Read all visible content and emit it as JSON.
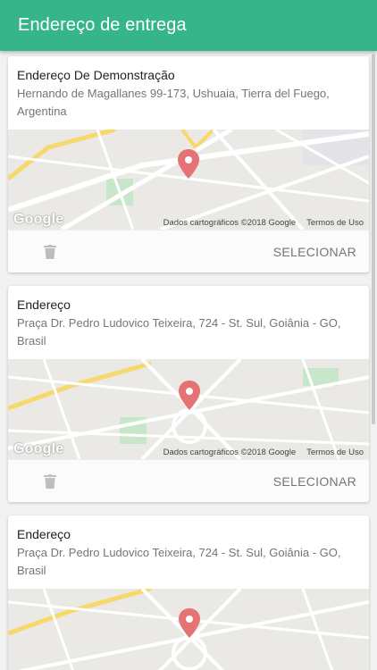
{
  "appbar": {
    "title": "Endereço de entrega"
  },
  "colors": {
    "primary": "#36b58a",
    "marker": "#e57373"
  },
  "addresses": [
    {
      "name": "Endereço De Demonstração",
      "address": "Hernando de Magallanes 99-173, Ushuaia, Tierra del Fuego, Argentina",
      "map_brand": "Google",
      "map_attribution": "Dados cartográficos ©2018 Google",
      "map_terms": "Termos de Uso",
      "delete_icon": "trash-icon",
      "select_label": "SELECIONAR"
    },
    {
      "name": "Endereço",
      "address": "Praça Dr. Pedro Ludovico Teixeira, 724 - St. Sul, Goiânia - GO, Brasil",
      "map_brand": "Google",
      "map_attribution": "Dados cartográficos ©2018 Google",
      "map_terms": "Termos de Uso",
      "delete_icon": "trash-icon",
      "select_label": "SELECIONAR"
    },
    {
      "name": "Endereço",
      "address": "Praça Dr. Pedro Ludovico Teixeira, 724 - St. Sul, Goiânia - GO, Brasil"
    }
  ]
}
